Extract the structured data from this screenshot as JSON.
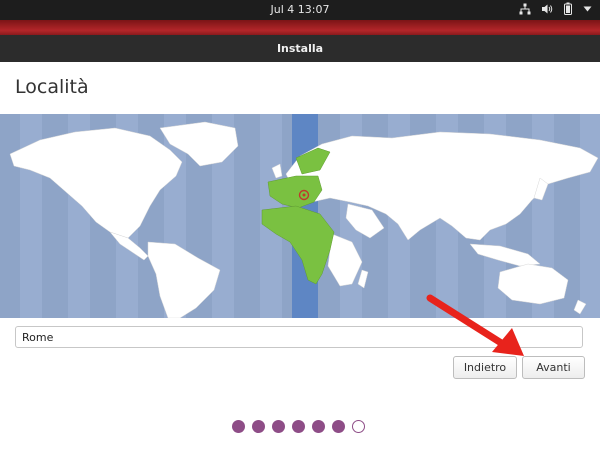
{
  "system_bar": {
    "clock": "Jul 4  13:07",
    "icons": [
      "network-icon",
      "volume-icon",
      "battery-icon",
      "system-menu-arrow-icon"
    ]
  },
  "window": {
    "title": "Installa"
  },
  "page": {
    "title": "Località"
  },
  "timezone": {
    "city_value": "Rome",
    "selected_zone_color": "#7ac141",
    "map_background": "#8ea4c7",
    "highlight_band": "#5e86c4"
  },
  "buttons": {
    "back": "Indietro",
    "next": "Avanti"
  },
  "progress": {
    "total_steps": 7,
    "current_step": 7,
    "dot_color": "#8e4d87"
  },
  "annotation": {
    "arrow_color": "#e8231c"
  }
}
